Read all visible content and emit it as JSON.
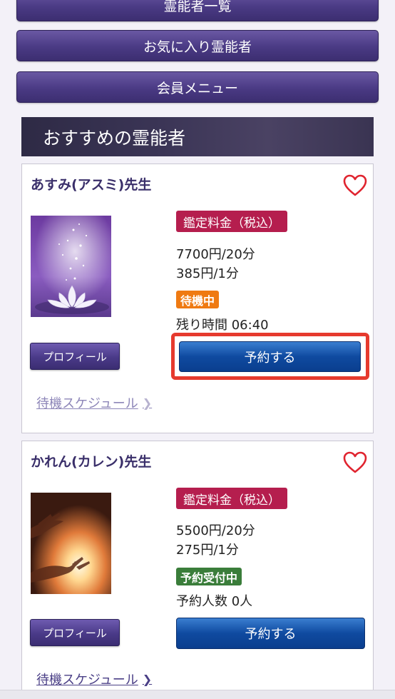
{
  "nav": {
    "top_partial": "霊能者一覧",
    "favorites": "お気に入り霊能者",
    "member_menu": "会員メニュー"
  },
  "section": {
    "title": "おすすめの霊能者"
  },
  "cards": [
    {
      "name": "あすみ(アスミ)先生",
      "fee_label": "鑑定料金（税込）",
      "price_20": "7700円/20分",
      "price_1": "385円/1分",
      "status": "待機中",
      "status_color": "#ef7a12",
      "info": "残り時間 06:40",
      "reserve": "予約する",
      "profile": "プロフィール",
      "schedule": "待機スケジュール",
      "photo_icon": "lotus-photo",
      "heart_icon": "heart-icon"
    },
    {
      "name": "かれん(カレン)先生",
      "fee_label": "鑑定料金（税込）",
      "price_20": "5500円/20分",
      "price_1": "275円/1分",
      "status": "予約受付中",
      "status_color": "#3a7d3a",
      "info": "予約人数 0人",
      "reserve": "予約する",
      "profile": "プロフィール",
      "schedule": "待機スケジュール",
      "photo_icon": "hands-light-photo",
      "heart_icon": "heart-icon"
    }
  ],
  "colors": {
    "accent_purple": "#4a3a84",
    "fee_badge": "#b51e4e",
    "reserve_blue": "#0f4aa0",
    "highlight_red": "#e63a2e"
  }
}
